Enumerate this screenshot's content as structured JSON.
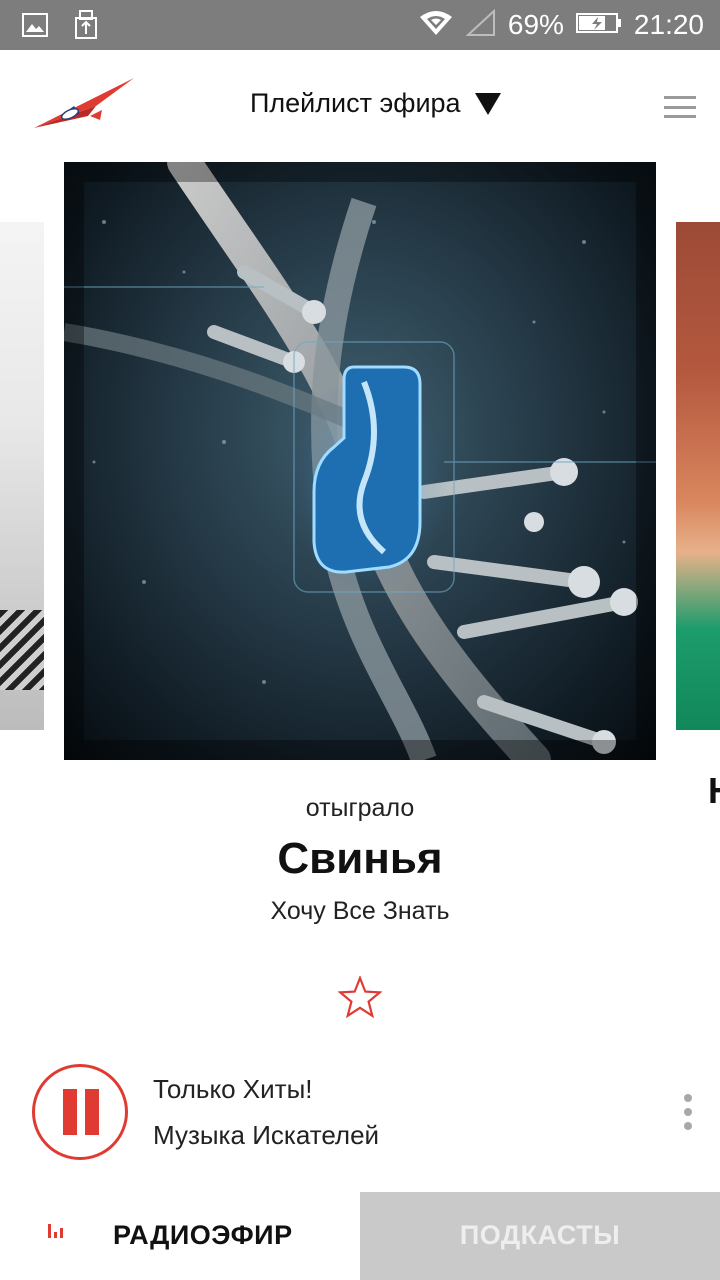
{
  "status_bar": {
    "battery": "69%",
    "time": "21:20",
    "icons": [
      "image-icon",
      "usb-icon",
      "wifi-icon",
      "signal-icon",
      "battery-icon"
    ]
  },
  "header": {
    "logo": "airplane-logo",
    "title": "Плейлист эфира",
    "dropdown_icon": "caret-down-icon",
    "menu_icon": "hamburger-menu-icon"
  },
  "now_playing": {
    "status": "отыграло",
    "title": "Свинья",
    "artist": "Хочу Все Знать",
    "favorite_icon": "star-outline-icon",
    "next_card_partial_text": "Н"
  },
  "player": {
    "state_icon": "pause-icon",
    "station": "Только Хиты!",
    "program": "Музыка Искателей",
    "more_icon": "more-vertical-icon"
  },
  "tabs": [
    {
      "label": "РАДИОЭФИР",
      "active": true,
      "icon": "equalizer-icon"
    },
    {
      "label": "ПОДКАСТЫ",
      "active": false
    }
  ],
  "colors": {
    "accent": "#e03b33",
    "status_bar": "#7d7d7d",
    "inactive_tab": "#c9c9c9"
  }
}
